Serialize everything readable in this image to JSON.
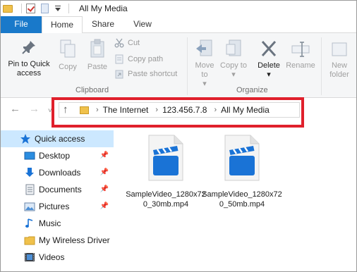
{
  "window": {
    "title": "All My Media"
  },
  "tabs": [
    {
      "label": "File"
    },
    {
      "label": "Home"
    },
    {
      "label": "Share"
    },
    {
      "label": "View"
    }
  ],
  "ribbon": {
    "clipboard": {
      "pin_label": "Pin to Quick access",
      "copy_label": "Copy",
      "paste_label": "Paste",
      "cut_label": "Cut",
      "copy_path_label": "Copy path",
      "paste_shortcut_label": "Paste shortcut",
      "group_label": "Clipboard"
    },
    "organize": {
      "move_to_label": "Move to",
      "copy_to_label": "Copy to",
      "delete_label": "Delete",
      "rename_label": "Rename",
      "group_label": "Organize"
    },
    "new": {
      "new_folder_label": "New folder"
    }
  },
  "address": {
    "crumbs": [
      "The Internet",
      "123.456.7.8",
      "All My Media"
    ]
  },
  "sidebar": {
    "items": [
      {
        "label": "Quick access",
        "icon": "star-icon",
        "active": true
      },
      {
        "label": "Desktop",
        "icon": "desktop-icon",
        "pinned": true
      },
      {
        "label": "Downloads",
        "icon": "download-icon",
        "pinned": true
      },
      {
        "label": "Documents",
        "icon": "documents-icon",
        "pinned": true
      },
      {
        "label": "Pictures",
        "icon": "pictures-icon",
        "pinned": true
      },
      {
        "label": "Music",
        "icon": "music-icon"
      },
      {
        "label": "My Wireless Driver",
        "icon": "folder-icon"
      },
      {
        "label": "Videos",
        "icon": "videos-icon"
      }
    ]
  },
  "files": [
    {
      "name": "SampleVideo_1280x720_30mb.mp4",
      "icon": "video-file-icon"
    },
    {
      "name": "SampleVideo_1280x720_50mb.mp4",
      "icon": "video-file-icon"
    }
  ],
  "colors": {
    "accent": "#1979ca",
    "selection": "#cce8ff",
    "highlight_box": "#e0202c",
    "video_icon_blue": "#1a73d6"
  }
}
